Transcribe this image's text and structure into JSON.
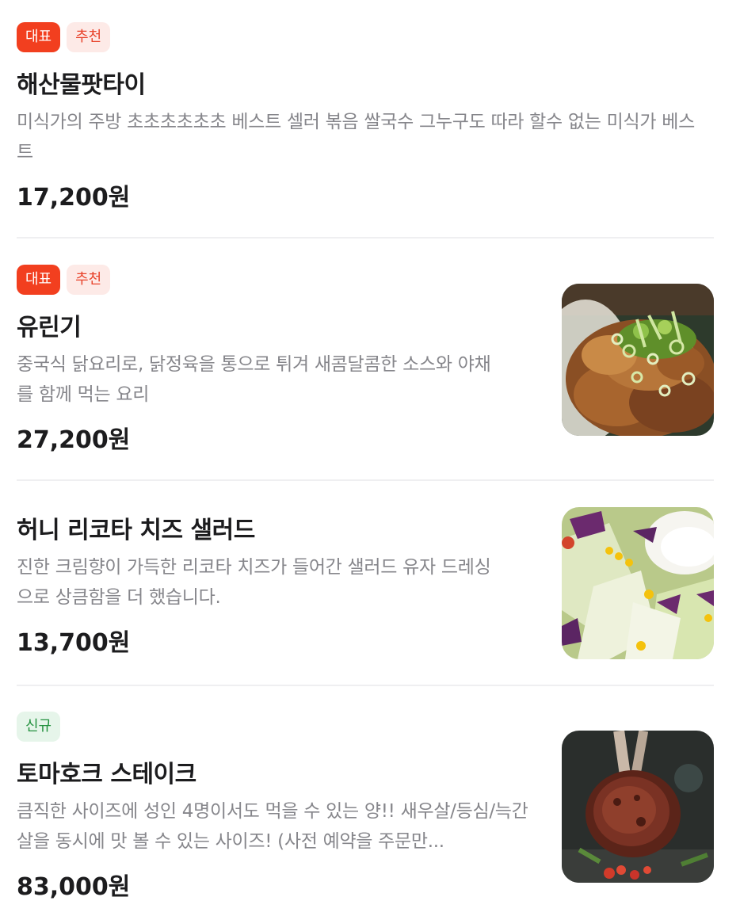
{
  "menu": {
    "items": [
      {
        "badges": [
          "대표",
          "추천"
        ],
        "name": "해산물팟타이",
        "description": "미식가의 주방 초초초초초초 베스트 셀러 볶음 쌀국수 그누구도 따라 할수 없는 미식가 베스트",
        "price": "17,200원"
      },
      {
        "badges": [
          "대표",
          "추천"
        ],
        "name": "유린기",
        "description": "중국식 닭요리로, 닭정육을 통으로 튀겨 새콤달콤한 소스와 야채를 함께 먹는 요리",
        "price": "27,200원",
        "image": "fried-chicken-with-scallions-photo"
      },
      {
        "name": "허니 리코타 치즈 샐러드",
        "description": "진한 크림향이 가득한 리코타 치즈가 들어간 샐러드 유자 드레싱으로 상큼함을 더 했습니다.",
        "price": "13,700원",
        "image": "salad-with-ricotta-photo"
      },
      {
        "badges": [
          "신규"
        ],
        "name": "토마호크 스테이크",
        "description": "큼직한 사이즈에 성인 4명이서도 먹을 수 있는 양!! 새우살/등심/늑간살을 동시에 맛 볼 수 있는 사이즈! (사전 예약을 주문만...",
        "price": "83,000원",
        "image": "tomahawk-steak-photo"
      }
    ]
  },
  "colors": {
    "badge_rep_bg": "#f23f1f",
    "badge_rec_bg": "#fdeae7",
    "badge_new_bg": "#e6f5ea",
    "description": "#86868b",
    "divider": "#efeff1"
  }
}
